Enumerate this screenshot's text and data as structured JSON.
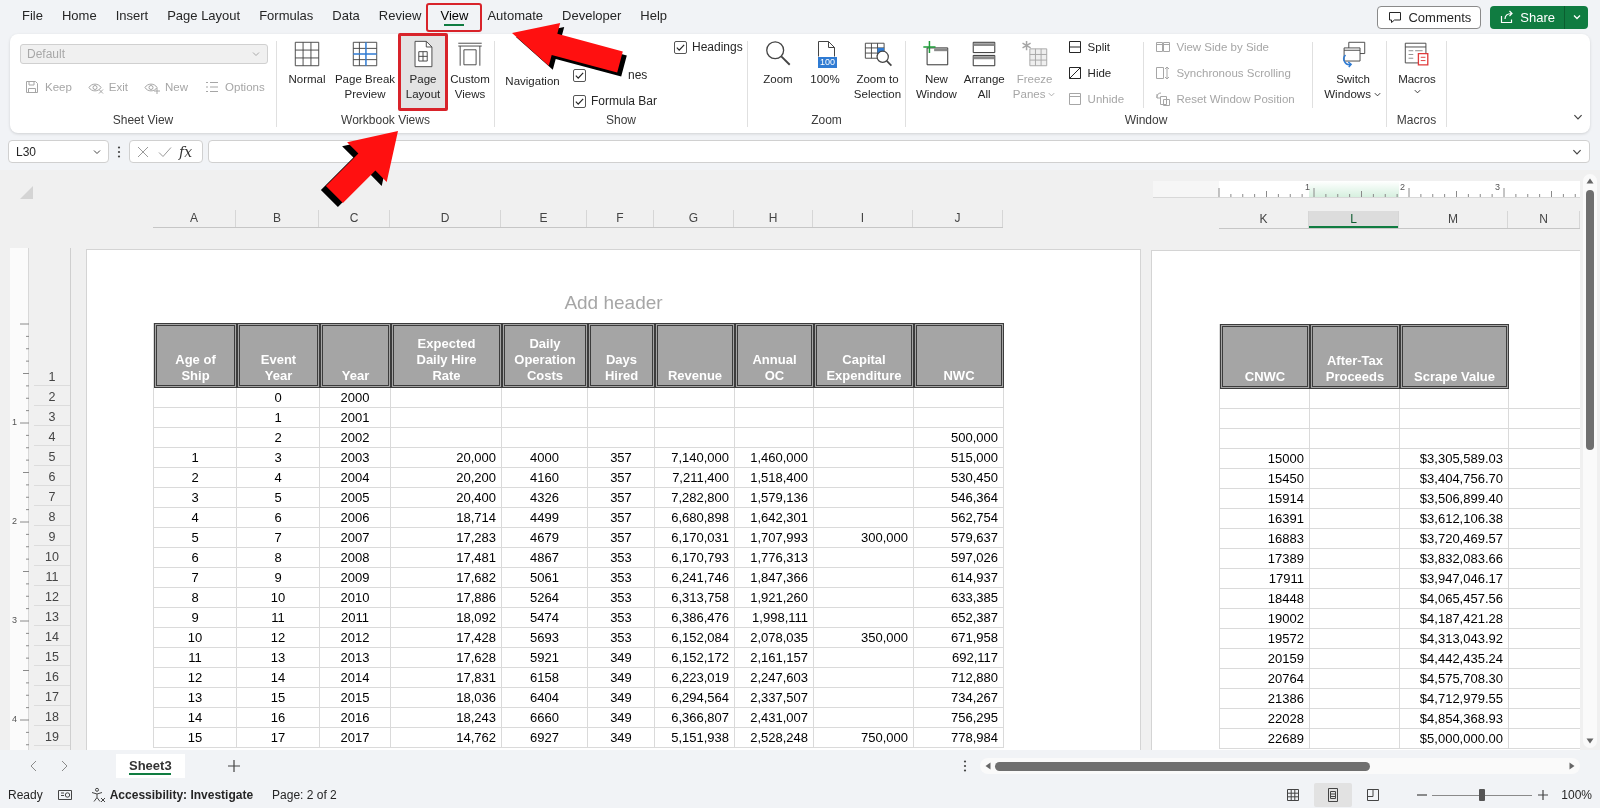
{
  "menu_tabs": [
    {
      "label": "File",
      "selected": false,
      "highlighted": false
    },
    {
      "label": "Home",
      "selected": false,
      "highlighted": false
    },
    {
      "label": "Insert",
      "selected": false,
      "highlighted": false
    },
    {
      "label": "Page Layout",
      "selected": false,
      "highlighted": false
    },
    {
      "label": "Formulas",
      "selected": false,
      "highlighted": false
    },
    {
      "label": "Data",
      "selected": false,
      "highlighted": false
    },
    {
      "label": "Review",
      "selected": false,
      "highlighted": false
    },
    {
      "label": "View",
      "selected": true,
      "highlighted": true
    },
    {
      "label": "Automate",
      "selected": false,
      "highlighted": false
    },
    {
      "label": "Developer",
      "selected": false,
      "highlighted": false
    },
    {
      "label": "Help",
      "selected": false,
      "highlighted": false
    }
  ],
  "account_buttons": {
    "comments": "Comments",
    "share": "Share"
  },
  "ribbon": {
    "sheet_view": {
      "title": "Sheet View",
      "view_select": {
        "value": "Default",
        "disabled": true
      },
      "actions": [
        {
          "label": "Keep",
          "kind": "save",
          "disabled": true
        },
        {
          "label": "Exit",
          "kind": "exit",
          "disabled": true
        },
        {
          "label": "New",
          "kind": "new",
          "disabled": true
        },
        {
          "label": "Options",
          "kind": "options",
          "disabled": true
        }
      ]
    },
    "workbook_views": {
      "title": "Workbook Views",
      "buttons": [
        {
          "label": "Normal",
          "kind": "normal",
          "selected": false,
          "highlighted": false
        },
        {
          "label": "Page Break Preview",
          "kind": "pagebreak",
          "selected": false,
          "highlighted": false
        },
        {
          "label": "Page Layout",
          "kind": "pagelayout",
          "selected": true,
          "highlighted": true
        },
        {
          "label": "Custom Views",
          "kind": "custom",
          "selected": false,
          "highlighted": false
        }
      ]
    },
    "show": {
      "title": "Show",
      "navigation": "Navigation",
      "checkboxes": [
        {
          "label": "nes",
          "checked": true
        },
        {
          "label": "Formula Bar",
          "checked": true
        },
        {
          "label": "Headings",
          "checked": true
        }
      ]
    },
    "zoom": {
      "title": "Zoom",
      "buttons": [
        {
          "label": "Zoom",
          "kind": "zoom"
        },
        {
          "label": "100%",
          "kind": "hundred",
          "badge": "100"
        },
        {
          "label": "Zoom to Selection",
          "kind": "selection"
        }
      ]
    },
    "window": {
      "title": "Window",
      "large_buttons": [
        {
          "label": "New Window",
          "kind": "new",
          "disabled": false,
          "dropdown": false
        },
        {
          "label": "Arrange All",
          "kind": "arrange",
          "disabled": false,
          "dropdown": false
        },
        {
          "label": "Freeze Panes",
          "kind": "freeze",
          "disabled": true,
          "dropdown": true
        }
      ],
      "pane_actions": [
        {
          "label": "Split",
          "kind": "split",
          "disabled": false
        },
        {
          "label": "Hide",
          "kind": "hide",
          "disabled": false
        },
        {
          "label": "Unhide",
          "kind": "unhide",
          "disabled": true
        }
      ],
      "compare_actions": [
        {
          "label": "View Side by Side",
          "kind": "side",
          "disabled": true
        },
        {
          "label": "Synchronous Scrolling",
          "kind": "sync",
          "disabled": true
        },
        {
          "label": "Reset Window Position",
          "kind": "reset",
          "disabled": true
        }
      ],
      "switch": {
        "label": "Switch Windows",
        "dropdown": true
      }
    },
    "macros": {
      "title": "Macros",
      "button": {
        "label": "Macros",
        "dropdown": true
      }
    }
  },
  "formula_bar": {
    "name_box": "L30",
    "function_label": "fx"
  },
  "sheet": {
    "top_ruler": [
      "1",
      "2",
      "3"
    ],
    "side_ruler": [
      "1",
      "2",
      "3",
      "4"
    ],
    "row_numbers": [
      "1",
      "2",
      "3",
      "4",
      "5",
      "6",
      "7",
      "8",
      "9",
      "10",
      "11",
      "12",
      "13",
      "14",
      "15",
      "16",
      "17",
      "18",
      "19"
    ],
    "pages": [
      {
        "header": "Add header",
        "column_letters": [
          {
            "label": "A",
            "selected": false
          },
          {
            "label": "B",
            "selected": false
          },
          {
            "label": "C",
            "selected": false
          },
          {
            "label": "D",
            "selected": false
          },
          {
            "label": "E",
            "selected": false
          },
          {
            "label": "F",
            "selected": false
          },
          {
            "label": "G",
            "selected": false
          },
          {
            "label": "H",
            "selected": false
          },
          {
            "label": "I",
            "selected": false
          },
          {
            "label": "J",
            "selected": false
          }
        ],
        "headings": [
          "Age of Ship",
          "Event Year",
          "Year",
          "Expected Daily Hire Rate",
          "Daily Operation Costs",
          "Days Hired",
          "Revenue",
          "Annual OC",
          "Capital Expenditure",
          "NWC"
        ],
        "rows": [
          [
            null,
            "0",
            "2000",
            null,
            null,
            null,
            null,
            null,
            null,
            null
          ],
          [
            null,
            "1",
            "2001",
            null,
            null,
            null,
            null,
            null,
            null,
            null
          ],
          [
            null,
            "2",
            "2002",
            null,
            null,
            null,
            null,
            null,
            null,
            "500,000"
          ],
          [
            "1",
            "3",
            "2003",
            "20,000",
            "4000",
            "357",
            "7,140,000",
            "1,460,000",
            null,
            "515,000"
          ],
          [
            "2",
            "4",
            "2004",
            "20,200",
            "4160",
            "357",
            "7,211,400",
            "1,518,400",
            null,
            "530,450"
          ],
          [
            "3",
            "5",
            "2005",
            "20,400",
            "4326",
            "357",
            "7,282,800",
            "1,579,136",
            null,
            "546,364"
          ],
          [
            "4",
            "6",
            "2006",
            "18,714",
            "4499",
            "357",
            "6,680,898",
            "1,642,301",
            null,
            "562,754"
          ],
          [
            "5",
            "7",
            "2007",
            "17,283",
            "4679",
            "357",
            "6,170,031",
            "1,707,993",
            "300,000",
            "579,637"
          ],
          [
            "6",
            "8",
            "2008",
            "17,481",
            "4867",
            "353",
            "6,170,793",
            "1,776,313",
            null,
            "597,026"
          ],
          [
            "7",
            "9",
            "2009",
            "17,682",
            "5061",
            "353",
            "6,241,746",
            "1,847,366",
            null,
            "614,937"
          ],
          [
            "8",
            "10",
            "2010",
            "17,886",
            "5264",
            "353",
            "6,313,758",
            "1,921,260",
            null,
            "633,385"
          ],
          [
            "9",
            "11",
            "2011",
            "18,092",
            "5474",
            "353",
            "6,386,476",
            "1,998,111",
            null,
            "652,387"
          ],
          [
            "10",
            "12",
            "2012",
            "17,428",
            "5693",
            "353",
            "6,152,084",
            "2,078,035",
            "350,000",
            "671,958"
          ],
          [
            "11",
            "13",
            "2013",
            "17,628",
            "5921",
            "349",
            "6,152,172",
            "2,161,157",
            null,
            "692,117"
          ],
          [
            "12",
            "14",
            "2014",
            "17,831",
            "6158",
            "349",
            "6,223,019",
            "2,247,603",
            null,
            "712,880"
          ],
          [
            "13",
            "15",
            "2015",
            "18,036",
            "6404",
            "349",
            "6,294,564",
            "2,337,507",
            null,
            "734,267"
          ],
          [
            "14",
            "16",
            "2016",
            "18,243",
            "6660",
            "349",
            "6,366,807",
            "2,431,007",
            null,
            "756,295"
          ],
          [
            "15",
            "17",
            "2017",
            "14,762",
            "6927",
            "349",
            "5,151,938",
            "2,528,248",
            "750,000",
            "778,984"
          ]
        ]
      },
      {
        "column_letters": [
          {
            "label": "K",
            "selected": false
          },
          {
            "label": "L",
            "selected": true
          },
          {
            "label": "M",
            "selected": false
          },
          {
            "label": "N",
            "selected": false
          }
        ],
        "headings": [
          "CNWC",
          "After-Tax Proceeds",
          "Scrape Value"
        ],
        "rows": [
          [
            null,
            null,
            null
          ],
          [
            null,
            null,
            null
          ],
          [
            null,
            null,
            null
          ],
          [
            "15000",
            null,
            "$3,305,589.03"
          ],
          [
            "15450",
            null,
            "$3,404,756.70"
          ],
          [
            "15914",
            null,
            "$3,506,899.40"
          ],
          [
            "16391",
            null,
            "$3,612,106.38"
          ],
          [
            "16883",
            null,
            "$3,720,469.57"
          ],
          [
            "17389",
            null,
            "$3,832,083.66"
          ],
          [
            "17911",
            null,
            "$3,947,046.17"
          ],
          [
            "18448",
            null,
            "$4,065,457.56"
          ],
          [
            "19002",
            null,
            "$4,187,421.28"
          ],
          [
            "19572",
            null,
            "$4,313,043.92"
          ],
          [
            "20159",
            null,
            "$4,442,435.24"
          ],
          [
            "20764",
            null,
            "$4,575,708.30"
          ],
          [
            "21386",
            null,
            "$4,712,979.55"
          ],
          [
            "22028",
            null,
            "$4,854,368.93"
          ],
          [
            "22689",
            null,
            "$5,000,000.00"
          ]
        ]
      }
    ]
  },
  "sheet_tabs": [
    {
      "label": "Sheet3",
      "selected": true
    }
  ],
  "status_bar": {
    "ready": "Ready",
    "accessibility": "Accessibility: Investigate",
    "page": "Page: 2 of 2",
    "views": [
      {
        "kind": "normal",
        "selected": false
      },
      {
        "kind": "pagelayout",
        "selected": true
      },
      {
        "kind": "pagebreak",
        "selected": false
      }
    ],
    "zoom_slider": {
      "level": 0.5
    },
    "zoom": "100%"
  }
}
